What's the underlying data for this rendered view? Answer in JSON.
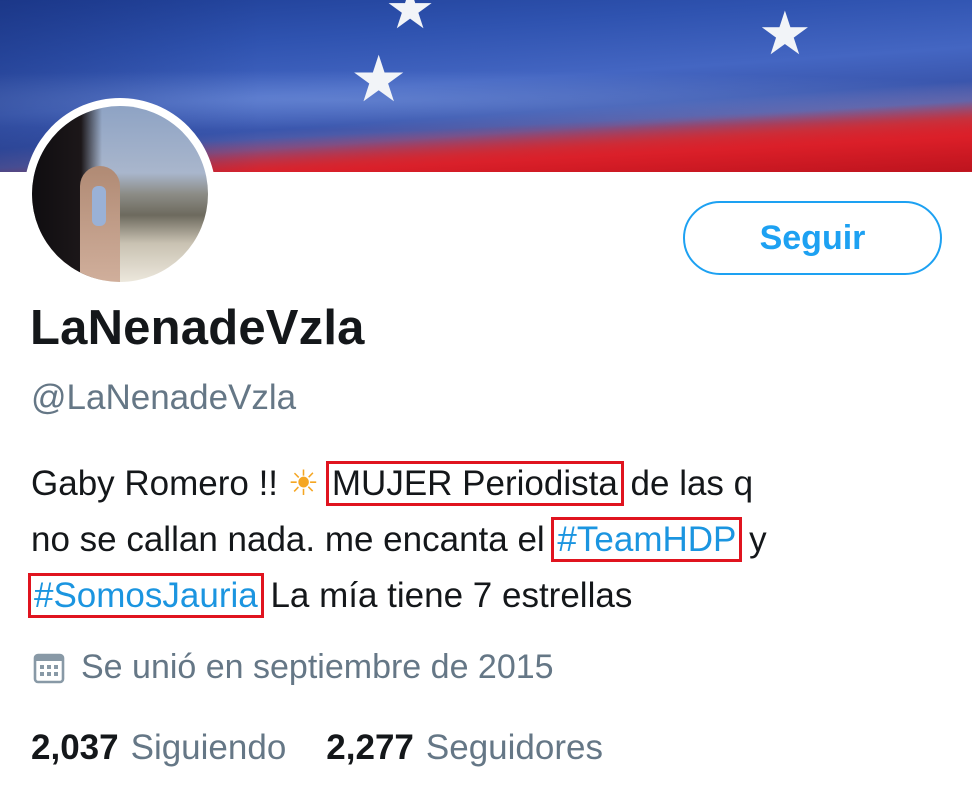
{
  "profile": {
    "display_name": "LaNenadeVzla",
    "handle": "@LaNenadeVzla",
    "follow_label": "Seguir",
    "bio": {
      "line1_a": "Gaby Romero !! ",
      "sun_icon": "☀",
      "line1_b": " ",
      "line1_highlight": "MUJER Periodista",
      "line1_c": " de las q",
      "line2_a": "no se callan nada. me encanta el ",
      "line2_hashtag": "#TeamHDP",
      "line2_b": " y",
      "line3_hashtag": "#SomosJauria",
      "line3_b": " La mía tiene 7 estrellas"
    },
    "joined": "Se unió en septiembre de 2015",
    "following_count": "2,037",
    "following_label": "Siguiendo",
    "followers_count": "2,277",
    "followers_label": "Seguidores"
  },
  "colors": {
    "accent": "#1da1f2",
    "highlight_box": "#e0141f",
    "hashtag": "#1b95e0",
    "secondary_text": "#657786"
  },
  "icons": [
    "calendar-icon",
    "sun-icon"
  ]
}
